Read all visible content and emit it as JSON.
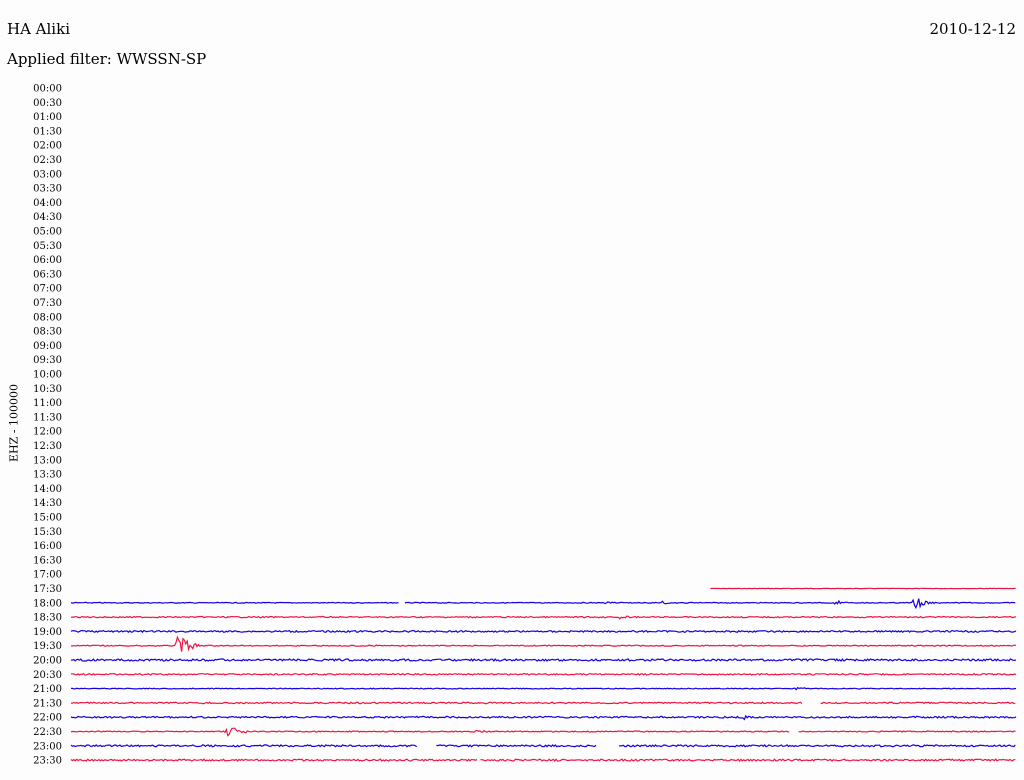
{
  "header": {
    "station": "HA Aliki",
    "date": "2010-12-12",
    "filter": "Applied filter: WWSSN-SP"
  },
  "colors": {
    "trace_a": "#1400e0",
    "trace_b": "#ee1440",
    "background": "#fdfdfd"
  },
  "chart_data": {
    "type": "line",
    "title": "HA Aliki",
    "ylabel": "EHZ - 100000",
    "time_labels": [
      "00:00",
      "00:30",
      "01:00",
      "01:30",
      "02:00",
      "02:30",
      "03:00",
      "03:30",
      "04:00",
      "04:30",
      "05:00",
      "05:30",
      "06:00",
      "06:30",
      "07:00",
      "07:30",
      "08:00",
      "08:30",
      "09:00",
      "09:30",
      "10:00",
      "10:30",
      "11:00",
      "11:30",
      "12:00",
      "12:30",
      "13:00",
      "13:30",
      "14:00",
      "14:30",
      "15:00",
      "15:30",
      "16:00",
      "16:30",
      "17:00",
      "17:30",
      "18:00",
      "18:30",
      "19:00",
      "19:30",
      "20:00",
      "20:30",
      "21:00",
      "21:30",
      "22:00",
      "22:30",
      "23:00",
      "23:30"
    ],
    "row_minutes": 30,
    "traces": [
      {
        "label": "17:30",
        "color": "red",
        "start_min": 20.3,
        "end_min": 30,
        "gaps": [],
        "events": [],
        "noise": 0.2
      },
      {
        "label": "18:00",
        "color": "blue",
        "start_min": 0,
        "end_min": 30,
        "gaps": [
          [
            10.4,
            10.6
          ]
        ],
        "events": [
          {
            "min": 26.8,
            "amp": 9
          },
          {
            "min": 24.3,
            "amp": 2
          },
          {
            "min": 18.8,
            "amp": 2
          },
          {
            "min": 17.0,
            "amp": 1.5
          }
        ],
        "noise": 0.4
      },
      {
        "label": "18:30",
        "color": "red",
        "start_min": 0,
        "end_min": 30,
        "gaps": [],
        "events": [
          {
            "min": 17.4,
            "amp": 2
          }
        ],
        "noise": 0.6
      },
      {
        "label": "19:00",
        "color": "blue",
        "start_min": 0,
        "end_min": 30,
        "gaps": [],
        "events": [],
        "noise": 0.8
      },
      {
        "label": "19:30",
        "color": "red",
        "start_min": 0,
        "end_min": 30,
        "gaps": [],
        "events": [
          {
            "min": 3.4,
            "amp": 18
          },
          {
            "min": 9.4,
            "amp": 1.5
          }
        ],
        "noise": 0.5
      },
      {
        "label": "20:00",
        "color": "blue",
        "start_min": 0,
        "end_min": 30,
        "gaps": [],
        "events": [],
        "noise": 1.0
      },
      {
        "label": "20:30",
        "color": "red",
        "start_min": 0,
        "end_min": 30,
        "gaps": [],
        "events": [],
        "noise": 0.7
      },
      {
        "label": "21:00",
        "color": "blue",
        "start_min": 0,
        "end_min": 30,
        "gaps": [],
        "events": [
          {
            "min": 23.0,
            "amp": 1.5
          }
        ],
        "noise": 0.4
      },
      {
        "label": "21:30",
        "color": "red",
        "start_min": 0,
        "end_min": 30,
        "gaps": [
          [
            23.2,
            23.8
          ]
        ],
        "events": [],
        "noise": 0.7
      },
      {
        "label": "22:00",
        "color": "blue",
        "start_min": 0,
        "end_min": 30,
        "gaps": [],
        "events": [
          {
            "min": 21.3,
            "amp": 2
          }
        ],
        "noise": 0.8
      },
      {
        "label": "22:30",
        "color": "red",
        "start_min": 0,
        "end_min": 30,
        "gaps": [
          [
            22.8,
            23.1
          ]
        ],
        "events": [
          {
            "min": 5.0,
            "amp": 7
          },
          {
            "min": 12.9,
            "amp": 2
          }
        ],
        "noise": 0.5
      },
      {
        "label": "23:00",
        "color": "blue",
        "start_min": 0,
        "end_min": 30,
        "gaps": [
          [
            11.0,
            11.6
          ],
          [
            16.7,
            17.4
          ]
        ],
        "events": [],
        "noise": 0.9
      },
      {
        "label": "23:30",
        "color": "red",
        "start_min": 0,
        "end_min": 30,
        "gaps": [
          [
            12.9,
            13.0
          ]
        ],
        "events": [],
        "noise": 0.9
      }
    ]
  }
}
